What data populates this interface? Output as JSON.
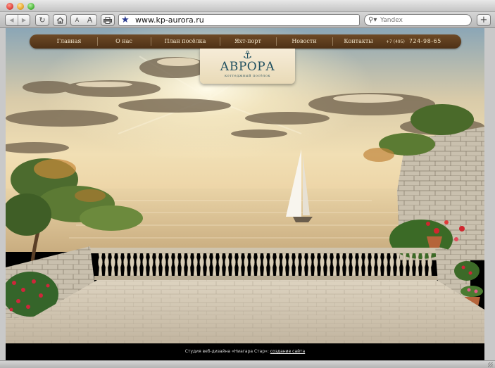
{
  "browser": {
    "url": "www.kp-aurora.ru",
    "search_placeholder": "Yandex",
    "icons": {
      "back": "left-arrow-icon",
      "forward": "right-arrow-icon",
      "reload": "reload-icon",
      "home": "home-icon",
      "text_small": "A",
      "text_large": "A",
      "print": "printer-icon",
      "bookmark": "star-icon",
      "search": "magnifier-icon",
      "add": "+"
    }
  },
  "nav": {
    "items": [
      {
        "label": "Главная"
      },
      {
        "label": "О нас"
      },
      {
        "label": "План посёлка"
      },
      {
        "label": "Яхт-порт"
      },
      {
        "label": "Новости"
      },
      {
        "label": "Контакты"
      }
    ],
    "phone_code": "+7 (495)",
    "phone_number": "724-98-65"
  },
  "logo": {
    "name": "АВРОРА",
    "subtitle": "коттеджный посёлок"
  },
  "footer": {
    "text": "Студия веб-дизайна «Ниагара Стар»:",
    "link": "создание сайта"
  },
  "colors": {
    "nav_bg": "#5e3d1e",
    "nav_text": "#f3e6cc",
    "logo_bg": "#f1e5cc",
    "logo_text": "#1f4f5f",
    "footer_bg": "#000000"
  }
}
